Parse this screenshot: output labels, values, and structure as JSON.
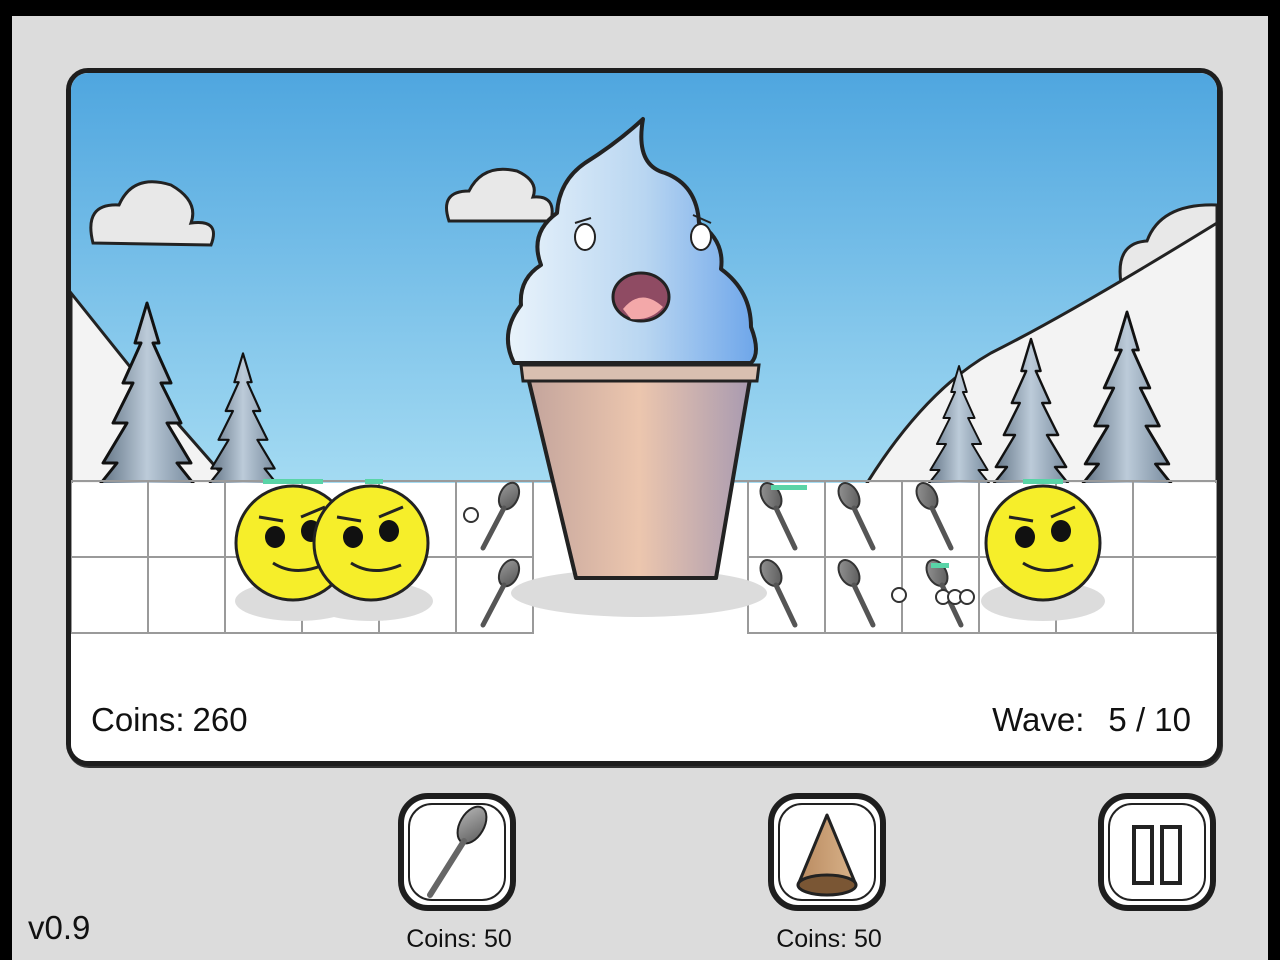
{
  "hud": {
    "coins_label": "Coins:",
    "coins_value": "260",
    "wave_label": "Wave:",
    "wave_value": "5 / 10"
  },
  "shop": {
    "spoon": {
      "cost": "Coins: 50",
      "icon": "spoon-icon"
    },
    "cone": {
      "cost": "Coins: 50",
      "icon": "cone-icon"
    }
  },
  "pause": {
    "icon": "pause-icon"
  },
  "version": "v0.9",
  "colors": {
    "sky_top": "#4fa6df",
    "sky_bottom": "#a6dcf3",
    "ice_cream": "#a8cdef",
    "cone": "#d9ab95",
    "enemy": "#f6ee2a",
    "health_bar": "#59d4a7",
    "frame": "#1e1e1e",
    "background": "#dcdcdc"
  }
}
